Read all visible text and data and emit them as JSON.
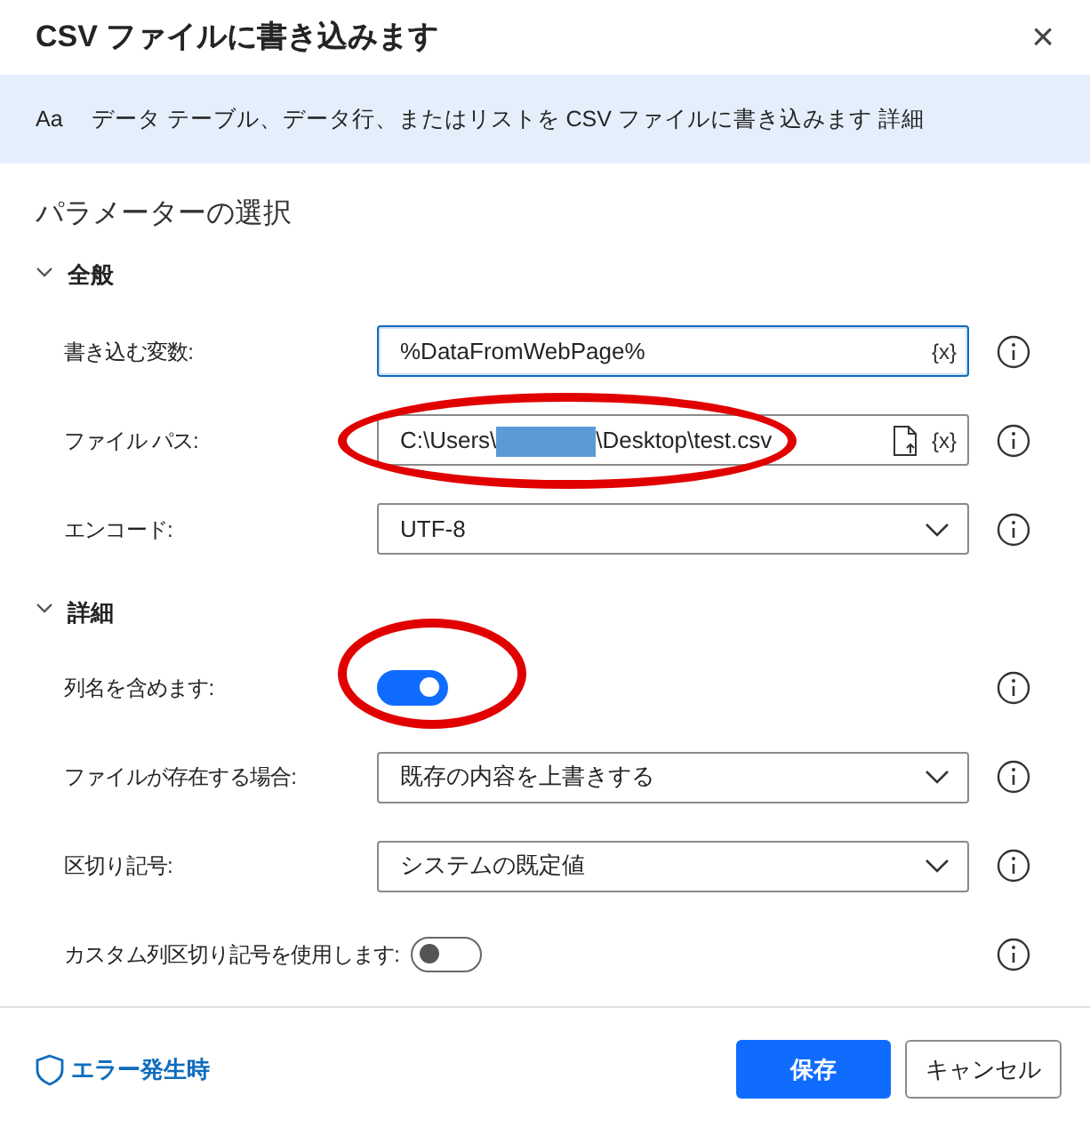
{
  "window": {
    "title": "CSV ファイルに書き込みます",
    "close": "×"
  },
  "banner": {
    "icon_text": "Aa",
    "text": "データ テーブル、データ行、またはリストを CSV ファイルに書き込みます",
    "link": "詳細"
  },
  "heading": "パラメーターの選択",
  "sections": [
    {
      "title": "全般",
      "expanded": true,
      "params": [
        {
          "kind": "text",
          "label": "書き込む変数:",
          "value": "%DataFromWebPage%",
          "focused": true,
          "var_button": "{x}",
          "highlighted": false
        },
        {
          "kind": "file",
          "label": "ファイル パス:",
          "value_before": "C:\\Users\\",
          "redacted": true,
          "value_after": "\\Desktop\\test.csv",
          "var_button": "{x}",
          "highlighted": true
        },
        {
          "kind": "dropdown",
          "label": "エンコード:",
          "value": "UTF-8",
          "highlighted": false
        }
      ]
    },
    {
      "title": "詳細",
      "expanded": true,
      "params": [
        {
          "kind": "toggle",
          "label": "列名を含めます:",
          "on": true,
          "highlighted": true
        },
        {
          "kind": "dropdown",
          "label": "ファイルが存在する場合:",
          "value": "既存の内容を上書きする",
          "highlighted": false
        },
        {
          "kind": "dropdown",
          "label": "区切り記号:",
          "value": "システムの既定値",
          "highlighted": false
        },
        {
          "kind": "toggle",
          "label": "カスタム列区切り記号を使用します:",
          "on": false,
          "highlighted": false
        }
      ]
    }
  ],
  "footer": {
    "error_link": "エラー発生時",
    "buttons": [
      {
        "label": "保存",
        "primary": true
      },
      {
        "label": "キャンセル",
        "primary": false
      }
    ]
  }
}
